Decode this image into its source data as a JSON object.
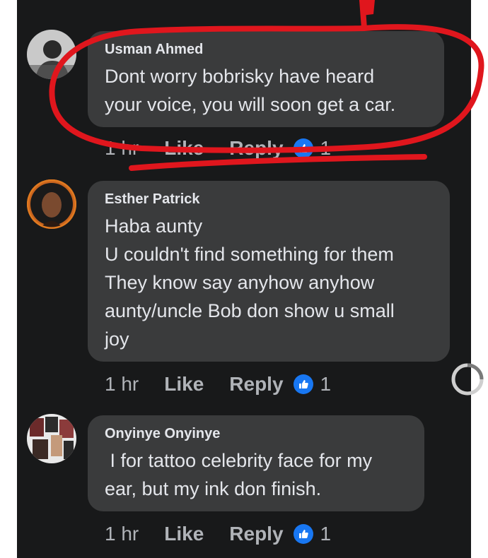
{
  "comments": [
    {
      "author": "Usman Ahmed",
      "text": "Dont worry bobrisky have heard\nyour voice, you will soon get a car.",
      "time": "1 hr",
      "like_label": "Like",
      "reply_label": "Reply",
      "reaction_count": "1"
    },
    {
      "author": "Esther Patrick",
      "text": "Haba aunty\nU couldn't find something for them\nThey know say anyhow anyhow\naunty/uncle Bob don show u small\njoy",
      "time": "1 hr",
      "like_label": "Like",
      "reply_label": "Reply",
      "reaction_count": "1"
    },
    {
      "author": "Onyinye Onyinye",
      "text": " I for tattoo celebrity face for my\near, but my ink don finish.",
      "time": "1 hr",
      "like_label": "Like",
      "reply_label": "Reply",
      "reaction_count": "1"
    }
  ],
  "icons": {
    "reaction": "like-thumb-icon",
    "loading": "loading-spinner-icon"
  },
  "colors": {
    "panel_bg": "#18191a",
    "bubble_bg": "#3a3b3c",
    "text": "#e4e6eb",
    "meta": "#b0b3b8",
    "like_blue": "#1877f2",
    "annotation_red": "#e0161d"
  }
}
